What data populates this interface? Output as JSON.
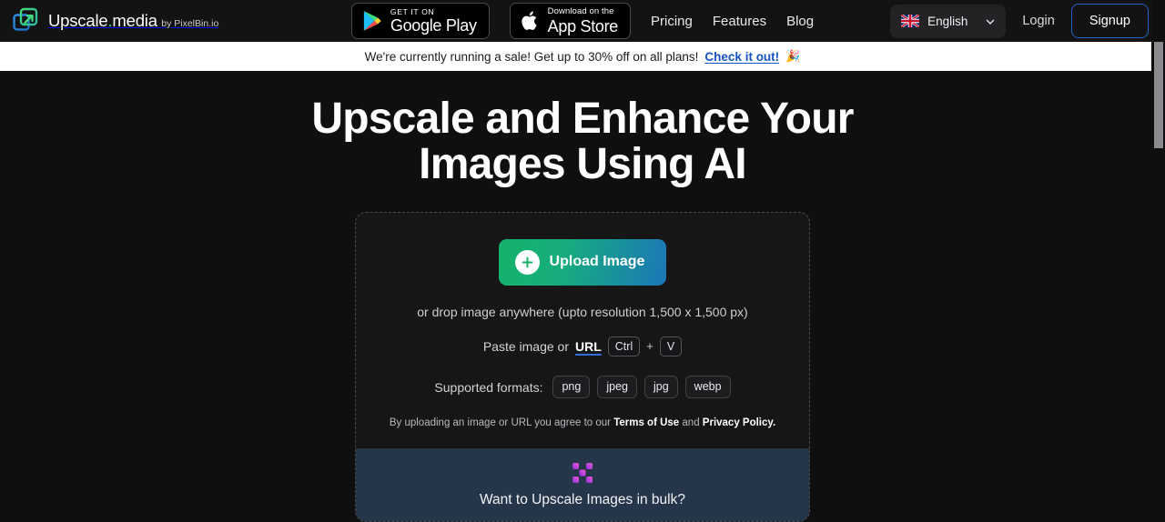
{
  "header": {
    "brand": {
      "name_main": "Upscale",
      "name_dot": ".",
      "name_suffix": "media",
      "by_prefix": "by PixelBin",
      "by_dot": ".",
      "by_suffix": "io",
      "logo_icon": "upscale-arrow-logo-icon"
    },
    "store_badges": [
      {
        "small": "GET IT ON",
        "big": "Google Play",
        "icon": "google-play-icon"
      },
      {
        "small": "Download on the",
        "big": "App Store",
        "icon": "apple-icon"
      }
    ],
    "nav_links": [
      {
        "label": "Pricing"
      },
      {
        "label": "Features"
      },
      {
        "label": "Blog"
      }
    ],
    "language": {
      "label": "English",
      "flag_icon": "uk-flag-icon",
      "chevron_icon": "chevron-down-icon"
    },
    "login_label": "Login",
    "signup_label": "Signup",
    "signup_border_color": "#2563c9"
  },
  "sale_banner": {
    "message": "We're currently running a sale! Get up to 30% off on all plans!",
    "link_label": "Check it out!",
    "emoji": "🎉",
    "background": "#ffffff",
    "link_color": "#1552c6"
  },
  "hero": {
    "title_line_1": "Upscale and Enhance Your",
    "title_line_2": "Images Using AI"
  },
  "upload_card": {
    "button_label": "Upload Image",
    "button_plus_icon": "plus-icon",
    "button_gradient_from": "#16b26a",
    "button_gradient_to": "#1b77b8",
    "drop_text": "or drop image anywhere (upto resolution 1,500 x 1,500 px)",
    "paste_prefix": "Paste image or",
    "paste_url_label": "URL",
    "key_ctrl": "Ctrl",
    "key_plus": "+",
    "key_v": "V",
    "formats_label": "Supported formats:",
    "formats": [
      "png",
      "jpeg",
      "jpg",
      "webp"
    ],
    "terms_prefix": "By uploading an image or URL you agree to our",
    "terms_link_1": "Terms of Use",
    "terms_and": "and",
    "terms_link_2": "Privacy Policy."
  },
  "bulk_bar": {
    "icon": "bulk-grid-icon",
    "text": "Want to Upscale Images in bulk?",
    "background": "#25364a"
  }
}
